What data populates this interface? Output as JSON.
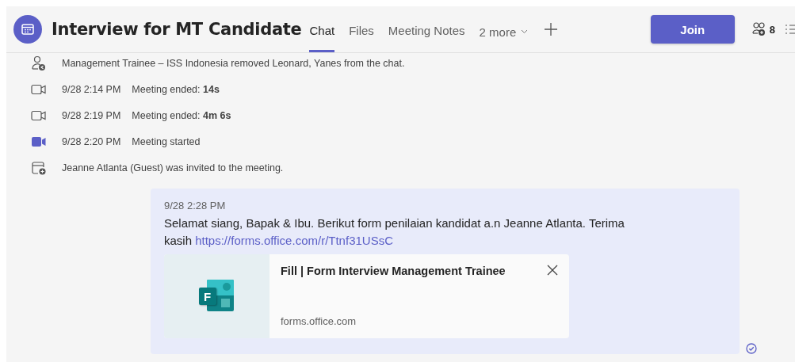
{
  "header": {
    "title": "Interview for MT Candidate",
    "tabs": [
      {
        "label": "Chat",
        "selected": true
      },
      {
        "label": "Files",
        "selected": false
      },
      {
        "label": "Meeting Notes",
        "selected": false
      }
    ],
    "more_tabs": "2 more",
    "join_button": "Join",
    "participant_count": "8"
  },
  "events": [
    {
      "kind": "removed",
      "text": "Management Trainee – ISS Indonesia removed Leonard, Yanes from the chat."
    },
    {
      "kind": "meeting_ended",
      "time": "9/28 2:14 PM",
      "text": "Meeting ended: **14s**"
    },
    {
      "kind": "meeting_ended",
      "time": "9/28 2:19 PM",
      "text": "Meeting ended: **4m 6s**"
    },
    {
      "kind": "meeting_started",
      "time": "9/28 2:20 PM",
      "text": "Meeting started"
    },
    {
      "kind": "invited",
      "text": "Jeanne Atlanta (Guest) was invited to the meeting."
    }
  ],
  "message": {
    "time": "9/28 2:28 PM",
    "text": "Selamat siang, Bapak & Ibu. Berikut form penilaian kandidat a.n Jeanne Atlanta. Terima kasih",
    "link": "https://forms.office.com/r/Ttnf31USsC",
    "preview": {
      "logo_letter": "F",
      "title": "Fill | Form Interview Management Trainee",
      "domain": "forms.office.com"
    },
    "seen": true
  }
}
